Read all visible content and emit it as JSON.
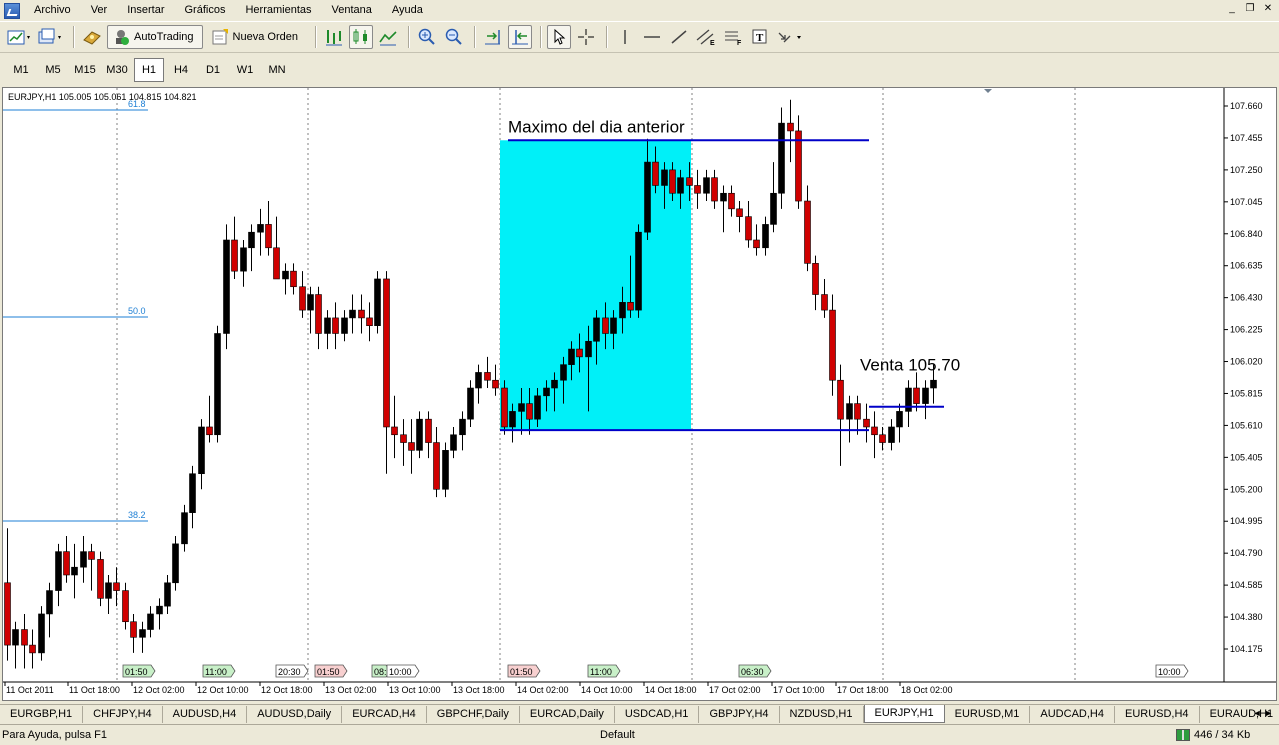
{
  "menu": {
    "items": [
      "Archivo",
      "Ver",
      "Insertar",
      "Gráficos",
      "Herramientas",
      "Ventana",
      "Ayuda"
    ]
  },
  "toolbar": {
    "autotrading_label": "AutoTrading",
    "new_order_label": "Nueva Orden"
  },
  "timeframes": [
    "M1",
    "M5",
    "M15",
    "M30",
    "H1",
    "H4",
    "D1",
    "W1",
    "MN"
  ],
  "active_timeframe": "H1",
  "chart": {
    "header": "EURJPY,H1  105.005 105.061 104.815 104.821",
    "annotation_max": "Maximo del dia anterior",
    "annotation_sell": "Venta 105.70",
    "fib_levels": [
      "61.8",
      "50.0",
      "38.2"
    ],
    "price_ticks": [
      "107.660",
      "107.455",
      "107.250",
      "107.045",
      "106.840",
      "106.635",
      "106.430",
      "106.225",
      "106.020",
      "105.815",
      "105.610",
      "105.405",
      "105.200",
      "104.995",
      "104.790",
      "104.585",
      "104.380",
      "104.175"
    ],
    "time_ticks": [
      "11 Oct 2011",
      "11 Oct 18:00",
      "12 Oct 02:00",
      "12 Oct 10:00",
      "12 Oct 18:00",
      "13 Oct 02:00",
      "13 Oct 10:00",
      "13 Oct 18:00",
      "14 Oct 02:00",
      "14 Oct 10:00",
      "14 Oct 18:00",
      "17 Oct 02:00",
      "17 Oct 10:00",
      "17 Oct 18:00",
      "18 Oct 02:00"
    ],
    "event_labels": [
      "01:50",
      "11:00",
      "20:30",
      "01:50",
      "08:",
      "10:00",
      "01:50",
      "11:00",
      "06:30",
      "10:00"
    ]
  },
  "chart_data": {
    "type": "candlestick",
    "symbol": "EURJPY",
    "timeframe": "H1",
    "ylim": [
      104.1,
      107.7
    ],
    "max_previous_day": 107.44,
    "sell_level": 105.73,
    "zone_low": 105.58,
    "candles": [
      [
        104.6,
        104.95,
        104.1,
        104.2
      ],
      [
        104.2,
        104.35,
        104.05,
        104.3
      ],
      [
        104.3,
        104.4,
        104.05,
        104.2
      ],
      [
        104.2,
        104.3,
        104.05,
        104.15
      ],
      [
        104.15,
        104.45,
        104.1,
        104.4
      ],
      [
        104.4,
        104.6,
        104.25,
        104.55
      ],
      [
        104.55,
        104.85,
        104.45,
        104.8
      ],
      [
        104.8,
        104.9,
        104.6,
        104.65
      ],
      [
        104.65,
        104.85,
        104.5,
        104.7
      ],
      [
        104.7,
        104.9,
        104.6,
        104.8
      ],
      [
        104.8,
        104.85,
        104.55,
        104.75
      ],
      [
        104.75,
        104.8,
        104.45,
        104.5
      ],
      [
        104.5,
        104.65,
        104.4,
        104.6
      ],
      [
        104.6,
        104.7,
        104.45,
        104.55
      ],
      [
        104.55,
        104.6,
        104.3,
        104.35
      ],
      [
        104.35,
        104.4,
        104.15,
        104.25
      ],
      [
        104.25,
        104.35,
        104.15,
        104.3
      ],
      [
        104.3,
        104.45,
        104.25,
        104.4
      ],
      [
        104.4,
        104.5,
        104.3,
        104.45
      ],
      [
        104.45,
        104.65,
        104.4,
        104.6
      ],
      [
        104.6,
        104.9,
        104.55,
        104.85
      ],
      [
        104.85,
        105.1,
        104.8,
        105.05
      ],
      [
        105.05,
        105.35,
        104.95,
        105.3
      ],
      [
        105.3,
        105.65,
        105.2,
        105.6
      ],
      [
        105.6,
        105.8,
        105.5,
        105.55
      ],
      [
        105.55,
        106.25,
        105.5,
        106.2
      ],
      [
        106.2,
        106.9,
        106.1,
        106.8
      ],
      [
        106.8,
        106.95,
        106.55,
        106.6
      ],
      [
        106.6,
        106.8,
        106.5,
        106.75
      ],
      [
        106.75,
        106.9,
        106.6,
        106.85
      ],
      [
        106.85,
        107.0,
        106.7,
        106.9
      ],
      [
        106.9,
        107.05,
        106.7,
        106.75
      ],
      [
        106.75,
        106.95,
        106.6,
        106.55
      ],
      [
        106.55,
        106.65,
        106.45,
        106.6
      ],
      [
        106.6,
        106.65,
        106.45,
        106.5
      ],
      [
        106.5,
        106.6,
        106.3,
        106.35
      ],
      [
        106.35,
        106.5,
        106.2,
        106.45
      ],
      [
        106.45,
        106.5,
        106.1,
        106.2
      ],
      [
        106.2,
        106.35,
        106.1,
        106.3
      ],
      [
        106.3,
        106.4,
        106.1,
        106.2
      ],
      [
        106.2,
        106.35,
        106.15,
        106.3
      ],
      [
        106.3,
        106.45,
        106.2,
        106.35
      ],
      [
        106.35,
        106.45,
        106.2,
        106.3
      ],
      [
        106.3,
        106.4,
        106.15,
        106.25
      ],
      [
        106.25,
        106.6,
        106.2,
        106.55
      ],
      [
        106.55,
        106.6,
        105.3,
        105.6
      ],
      [
        105.6,
        105.8,
        105.4,
        105.55
      ],
      [
        105.55,
        105.65,
        105.35,
        105.5
      ],
      [
        105.5,
        105.65,
        105.3,
        105.45
      ],
      [
        105.45,
        105.7,
        105.4,
        105.65
      ],
      [
        105.65,
        105.7,
        105.4,
        105.5
      ],
      [
        105.5,
        105.6,
        105.15,
        105.2
      ],
      [
        105.2,
        105.5,
        105.15,
        105.45
      ],
      [
        105.45,
        105.6,
        105.4,
        105.55
      ],
      [
        105.55,
        105.7,
        105.45,
        105.65
      ],
      [
        105.65,
        105.9,
        105.6,
        105.85
      ],
      [
        105.85,
        106.0,
        105.75,
        105.95
      ],
      [
        105.95,
        106.05,
        105.85,
        105.9
      ],
      [
        105.9,
        106.0,
        105.8,
        105.85
      ],
      [
        105.85,
        105.9,
        105.55,
        105.6
      ],
      [
        105.6,
        105.75,
        105.5,
        105.7
      ],
      [
        105.7,
        105.85,
        105.55,
        105.75
      ],
      [
        105.75,
        105.85,
        105.55,
        105.65
      ],
      [
        105.65,
        105.85,
        105.6,
        105.8
      ],
      [
        105.8,
        105.9,
        105.7,
        105.85
      ],
      [
        105.85,
        105.95,
        105.7,
        105.9
      ],
      [
        105.9,
        106.05,
        105.75,
        106.0
      ],
      [
        106.0,
        106.15,
        105.9,
        106.1
      ],
      [
        106.1,
        106.2,
        105.95,
        106.05
      ],
      [
        106.05,
        106.25,
        105.7,
        106.15
      ],
      [
        106.15,
        106.35,
        106.0,
        106.3
      ],
      [
        106.3,
        106.4,
        106.1,
        106.2
      ],
      [
        106.2,
        106.35,
        106.1,
        106.3
      ],
      [
        106.3,
        106.5,
        106.2,
        106.4
      ],
      [
        106.4,
        106.7,
        106.3,
        106.35
      ],
      [
        106.35,
        106.9,
        106.3,
        106.85
      ],
      [
        106.85,
        107.45,
        106.8,
        107.3
      ],
      [
        107.3,
        107.4,
        107.1,
        107.15
      ],
      [
        107.15,
        107.3,
        107.0,
        107.25
      ],
      [
        107.25,
        107.3,
        107.05,
        107.1
      ],
      [
        107.1,
        107.25,
        107.0,
        107.2
      ],
      [
        107.2,
        107.3,
        107.05,
        107.15
      ],
      [
        107.15,
        107.25,
        107.0,
        107.1
      ],
      [
        107.1,
        107.25,
        107.05,
        107.2
      ],
      [
        107.2,
        107.25,
        107.0,
        107.05
      ],
      [
        107.05,
        107.15,
        106.85,
        107.1
      ],
      [
        107.1,
        107.15,
        106.95,
        107.0
      ],
      [
        107.0,
        107.05,
        106.85,
        106.95
      ],
      [
        106.95,
        107.05,
        106.75,
        106.8
      ],
      [
        106.8,
        106.9,
        106.7,
        106.75
      ],
      [
        106.75,
        106.95,
        106.7,
        106.9
      ],
      [
        106.9,
        107.3,
        106.85,
        107.1
      ],
      [
        107.1,
        107.65,
        107.0,
        107.55
      ],
      [
        107.55,
        107.7,
        107.3,
        107.5
      ],
      [
        107.5,
        107.6,
        107.0,
        107.05
      ],
      [
        107.05,
        107.15,
        106.6,
        106.65
      ],
      [
        106.65,
        106.7,
        106.35,
        106.45
      ],
      [
        106.45,
        106.55,
        106.3,
        106.35
      ],
      [
        106.35,
        106.45,
        105.8,
        105.9
      ],
      [
        105.9,
        106.0,
        105.35,
        105.65
      ],
      [
        105.65,
        105.8,
        105.5,
        105.75
      ],
      [
        105.75,
        105.8,
        105.55,
        105.65
      ],
      [
        105.65,
        105.75,
        105.5,
        105.6
      ],
      [
        105.6,
        105.7,
        105.4,
        105.55
      ],
      [
        105.55,
        105.6,
        105.45,
        105.5
      ],
      [
        105.5,
        105.65,
        105.45,
        105.6
      ],
      [
        105.6,
        105.75,
        105.5,
        105.7
      ],
      [
        105.7,
        105.9,
        105.6,
        105.85
      ],
      [
        105.85,
        105.95,
        105.7,
        105.75
      ],
      [
        105.75,
        105.9,
        105.65,
        105.85
      ],
      [
        105.85,
        106.0,
        105.75,
        105.9
      ]
    ]
  }
}
